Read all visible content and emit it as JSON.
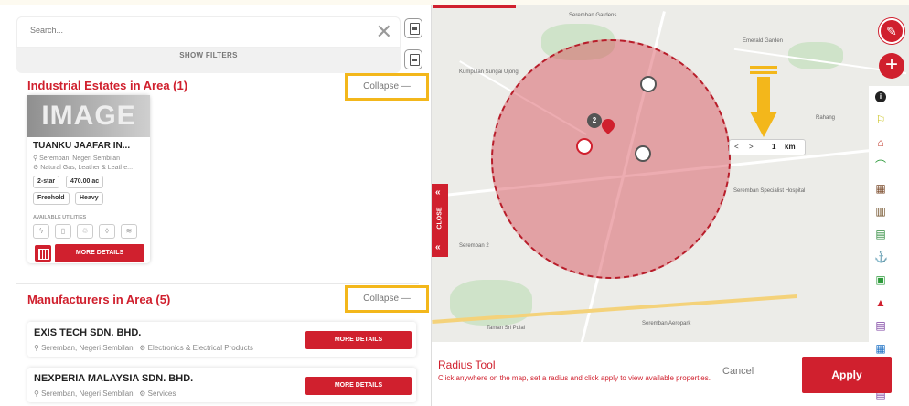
{
  "search": {
    "placeholder": "Search...",
    "show_filters": "SHOW FILTERS"
  },
  "estates": {
    "title": "Industrial Estates in Area (1)",
    "collapse": "Collapse —",
    "card": {
      "image_text": "IMAGE",
      "name": "TUANKU JAAFAR IN...",
      "location": "Seremban, Negeri Sembilan",
      "industries": "Natural Gas, Leather & Leathe...",
      "tags_row1": [
        "2-star",
        "470.00 ac"
      ],
      "tags_row2": [
        "Freehold",
        "Heavy"
      ],
      "utilities_label": "AVAILABLE UTILITIES",
      "utilities": [
        "electricity-icon",
        "gas-icon",
        "recycle-icon",
        "water-icon",
        "wifi-icon"
      ],
      "more_details": "MORE DETAILS"
    }
  },
  "manufacturers": {
    "title": "Manufacturers in Area (5)",
    "collapse": "Collapse —",
    "items": [
      {
        "name": "EXIS TECH SDN. BHD.",
        "location": "Seremban, Negeri Sembilan",
        "category": "Electronics & Electrical Products",
        "button": "MORE DETAILS"
      },
      {
        "name": "NEXPERIA MALAYSIA SDN. BHD.",
        "location": "Seremban, Negeri Sembilan",
        "category": "Services",
        "button": "MORE DETAILS"
      }
    ]
  },
  "map": {
    "close_label": "CLOSE",
    "cluster_count": "2",
    "scale": {
      "prev": "<",
      "next": ">",
      "value": "1",
      "unit": "km"
    },
    "labels": [
      "Seremban Gardens",
      "Emerald Garden",
      "Kumpulan Sungai Ujong",
      "Seremban Specialist Hospital",
      "Seremban 2",
      "Rahang",
      "Taman Sri Pulai",
      "Seremban Aeropark"
    ]
  },
  "radius_tool": {
    "title": "Radius Tool",
    "description": "Click anywhere on the map, set a radius and click apply to view available properties.",
    "cancel": "Cancel",
    "apply": "Apply"
  },
  "colors": {
    "accent": "#d0202e",
    "highlight": "#f3b71b",
    "radius_fill": "#d64852"
  }
}
